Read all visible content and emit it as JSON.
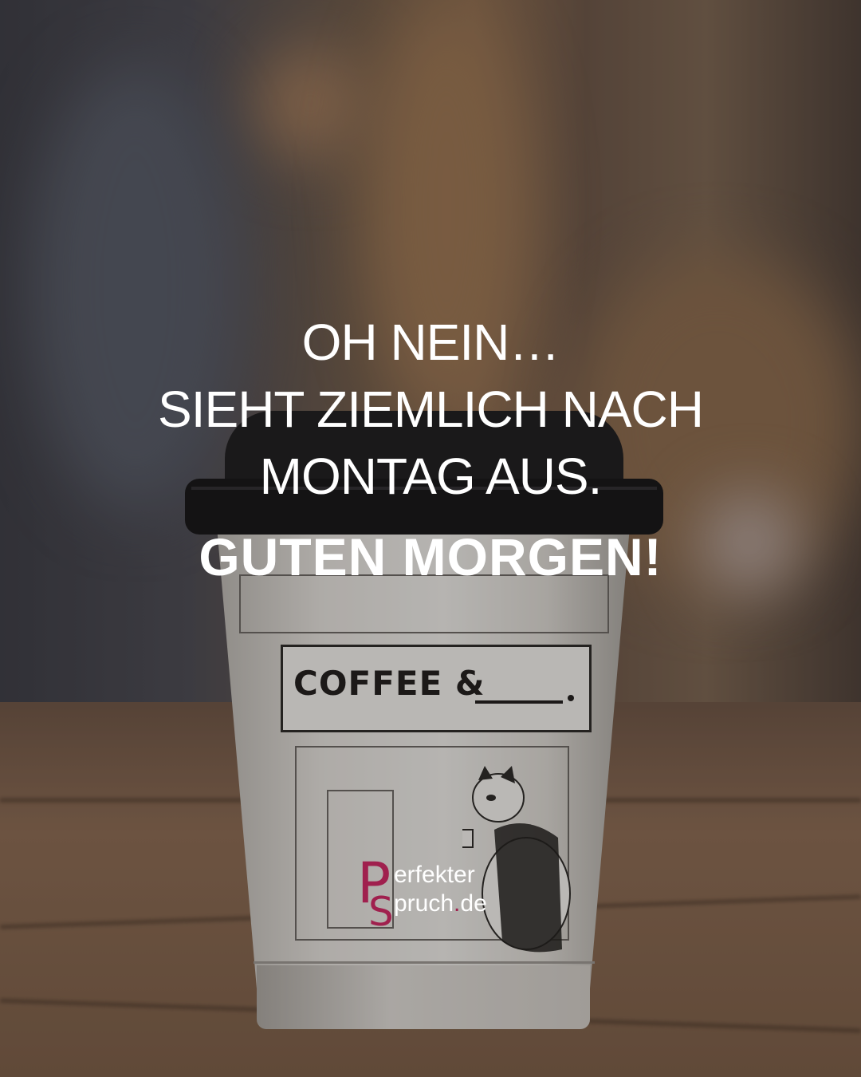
{
  "headline": {
    "line1": "OH NEIN…",
    "line2": "SIEHT ZIEMLICH NACH",
    "line3": "MONTAG AUS.",
    "line4": "GUTEN MORGEN!"
  },
  "cup": {
    "sign_text": "COFFEE &"
  },
  "logo": {
    "p_letter": "P",
    "s_letter": "S",
    "word1": "erfekter",
    "word2_main": "pruch",
    "word2_dot": ".",
    "word2_tld": "de"
  },
  "colors": {
    "text": "#ffffff",
    "brand": "#a0204e",
    "lid": "#1d1c1e"
  }
}
